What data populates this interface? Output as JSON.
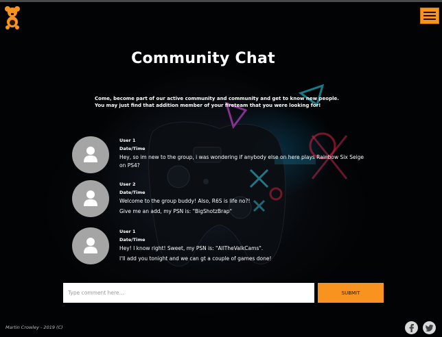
{
  "header": {
    "logo_icon": "teddy-bear-icon",
    "menu_icon": "hamburger-menu-icon",
    "accent_color": "#f7931e"
  },
  "page": {
    "title": "Community Chat",
    "intro_line1": "Come, become part of our active community and community and get to know new people.",
    "intro_line2": "You may just find that addition member of your fireteam that you were looking for!"
  },
  "messages": [
    {
      "user": "User 1",
      "date": "Date/Time",
      "text": "Hey, so im new to the group, i was wondering if anybody else on here plays Rainbow Six Seige on PS4?",
      "text2": ""
    },
    {
      "user": "User 2",
      "date": "Date/Time",
      "text": "Welcome to the group buddy! Also, R6S is life no?!",
      "text2": "Give me an add, my PSN is: \"BigShotzBrap\""
    },
    {
      "user": "User 1",
      "date": "Date/Time",
      "text": "Hey! I know right! Sweet, my PSN is: \"AllTheValkCams\".",
      "text2": "I'll add you tonight and we can gt a couple of games done!"
    }
  ],
  "comment": {
    "placeholder": "Type comment here...",
    "value": "",
    "submit_label": "SUBMIT"
  },
  "footer": {
    "copyright": "Martin Crowley - 2019 (C)",
    "social_icons": [
      "facebook-icon",
      "twitter-icon"
    ]
  }
}
